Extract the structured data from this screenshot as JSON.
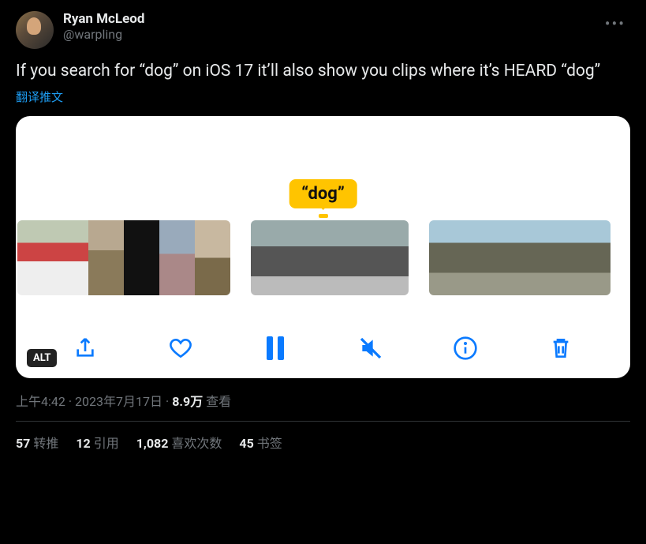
{
  "author": {
    "display_name": "Ryan McLeod",
    "handle": "@warpling"
  },
  "tweet_text": "If you search for “dog” on iOS 17 it’ll also show you clips where it’s HEARD “dog”",
  "translate_label": "翻译推文",
  "media": {
    "bubble_text": "“dog”",
    "alt_badge": "ALT",
    "toolbar": {
      "share": "share",
      "like": "like",
      "pause": "pause",
      "mute": "mute",
      "info": "info",
      "delete": "delete"
    }
  },
  "meta": {
    "time": "上午4:42",
    "date": "2023年7月17日",
    "views_count": "8.9万",
    "views_label": "查看"
  },
  "stats": {
    "retweets": {
      "count": "57",
      "label": "转推"
    },
    "quotes": {
      "count": "12",
      "label": "引用"
    },
    "likes": {
      "count": "1,082",
      "label": "喜欢次数"
    },
    "bookmarks": {
      "count": "45",
      "label": "书签"
    }
  }
}
